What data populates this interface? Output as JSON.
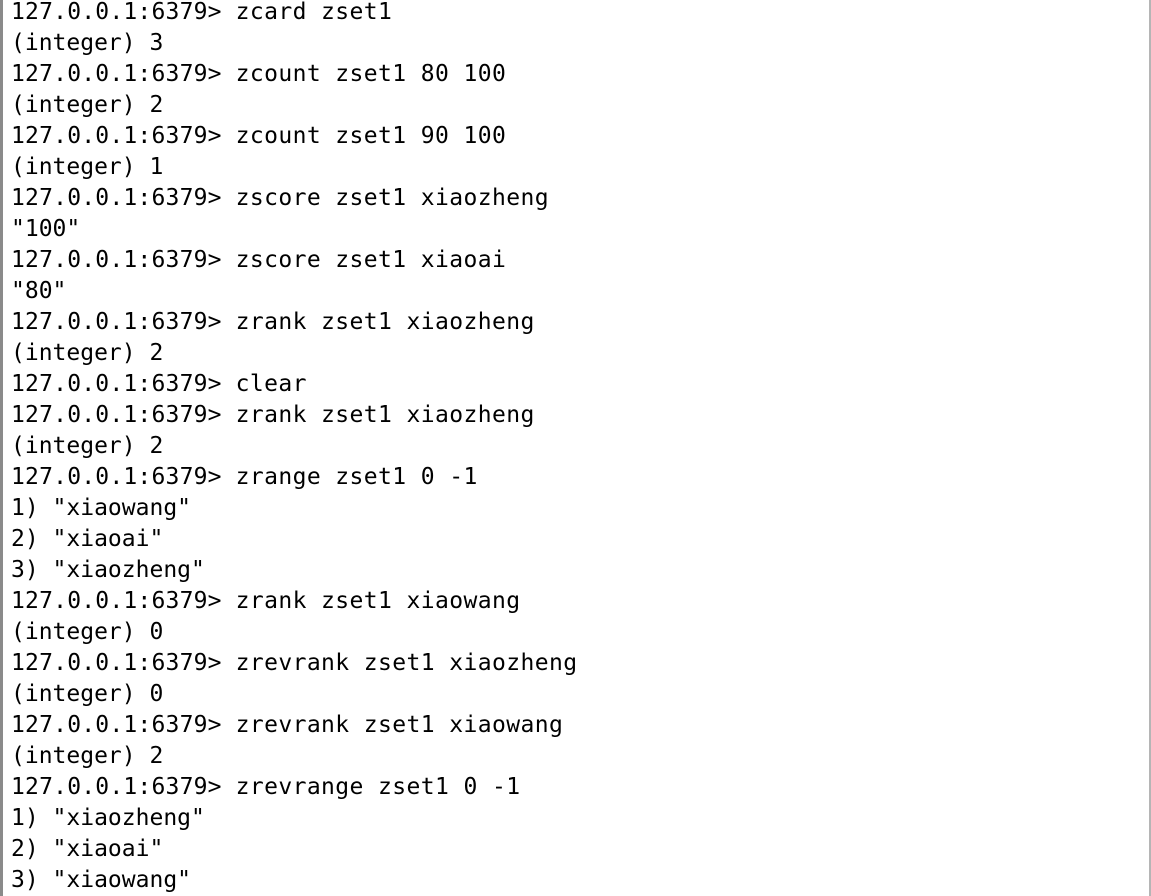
{
  "terminal": {
    "lines": [
      {
        "prompt": "127.0.0.1:6379>",
        "text": "zcard zset1"
      },
      {
        "prompt": "",
        "text": "(integer) 3"
      },
      {
        "prompt": "127.0.0.1:6379>",
        "text": "zcount zset1 80 100"
      },
      {
        "prompt": "",
        "text": "(integer) 2"
      },
      {
        "prompt": "127.0.0.1:6379>",
        "text": "zcount zset1 90 100"
      },
      {
        "prompt": "",
        "text": "(integer) 1"
      },
      {
        "prompt": "127.0.0.1:6379>",
        "text": "zscore zset1 xiaozheng"
      },
      {
        "prompt": "",
        "text": "\"100\""
      },
      {
        "prompt": "127.0.0.1:6379>",
        "text": "zscore zset1 xiaoai"
      },
      {
        "prompt": "",
        "text": "\"80\""
      },
      {
        "prompt": "127.0.0.1:6379>",
        "text": "zrank zset1 xiaozheng"
      },
      {
        "prompt": "",
        "text": "(integer) 2"
      },
      {
        "prompt": "127.0.0.1:6379>",
        "text": "clear"
      },
      {
        "prompt": "127.0.0.1:6379>",
        "text": "zrank zset1 xiaozheng"
      },
      {
        "prompt": "",
        "text": "(integer) 2"
      },
      {
        "prompt": "127.0.0.1:6379>",
        "text": "zrange zset1 0 -1"
      },
      {
        "prompt": "",
        "text": "1) \"xiaowang\""
      },
      {
        "prompt": "",
        "text": "2) \"xiaoai\""
      },
      {
        "prompt": "",
        "text": "3) \"xiaozheng\""
      },
      {
        "prompt": "127.0.0.1:6379>",
        "text": "zrank zset1 xiaowang"
      },
      {
        "prompt": "",
        "text": "(integer) 0"
      },
      {
        "prompt": "127.0.0.1:6379>",
        "text": "zrevrank zset1 xiaozheng"
      },
      {
        "prompt": "",
        "text": "(integer) 0"
      },
      {
        "prompt": "127.0.0.1:6379>",
        "text": "zrevrank zset1 xiaowang"
      },
      {
        "prompt": "",
        "text": "(integer) 2"
      },
      {
        "prompt": "127.0.0.1:6379>",
        "text": "zrevrange zset1 0 -1"
      },
      {
        "prompt": "",
        "text": "1) \"xiaozheng\""
      },
      {
        "prompt": "",
        "text": "2) \"xiaoai\""
      },
      {
        "prompt": "",
        "text": "3) \"xiaowang\""
      }
    ]
  },
  "colors": {
    "background": "#ffffff",
    "text": "#000000",
    "border": "#8a8a8a"
  }
}
